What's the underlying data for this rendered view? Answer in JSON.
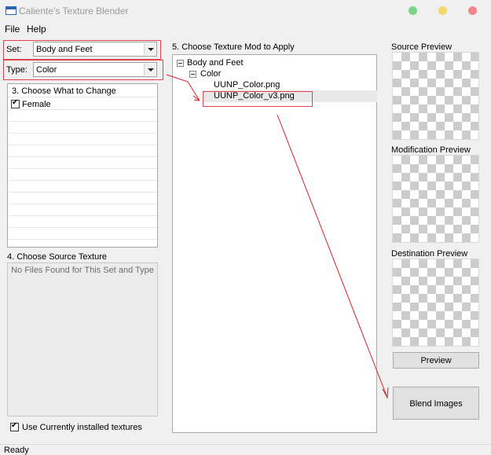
{
  "window": {
    "title": "Caliente's Texture Blender",
    "control_colors": [
      "#7ed48a",
      "#f2d86a",
      "#f1868e"
    ]
  },
  "menu": {
    "items": [
      "File",
      "Help"
    ]
  },
  "set": {
    "label": "Set:",
    "value": "Body and Feet"
  },
  "type": {
    "label": "Type:",
    "value": "Color"
  },
  "change": {
    "header": "3. Choose What to Change",
    "items": [
      {
        "label": "Female",
        "checked": true
      }
    ]
  },
  "source_texture": {
    "header": "4. Choose Source Texture",
    "empty_message": "No Files Found for This Set and Type"
  },
  "use_installed": {
    "label": "Use Currently installed textures",
    "checked": true
  },
  "mods": {
    "header": "5. Choose Texture Mod to Apply",
    "tree": {
      "root": "Body and Feet",
      "child": "Color",
      "files": [
        "UUNP_Color.png",
        "UUNP_Color_v3.png"
      ],
      "selected_index": 1
    }
  },
  "previews": {
    "source": "Source Preview",
    "modification": "Modification Preview",
    "destination": "Destination Preview"
  },
  "buttons": {
    "preview": "Preview",
    "blend": "Blend Images"
  },
  "status": "Ready",
  "colors": {
    "annotation_red": "#d81f2a",
    "selection_gray": "#e9e9e9"
  }
}
